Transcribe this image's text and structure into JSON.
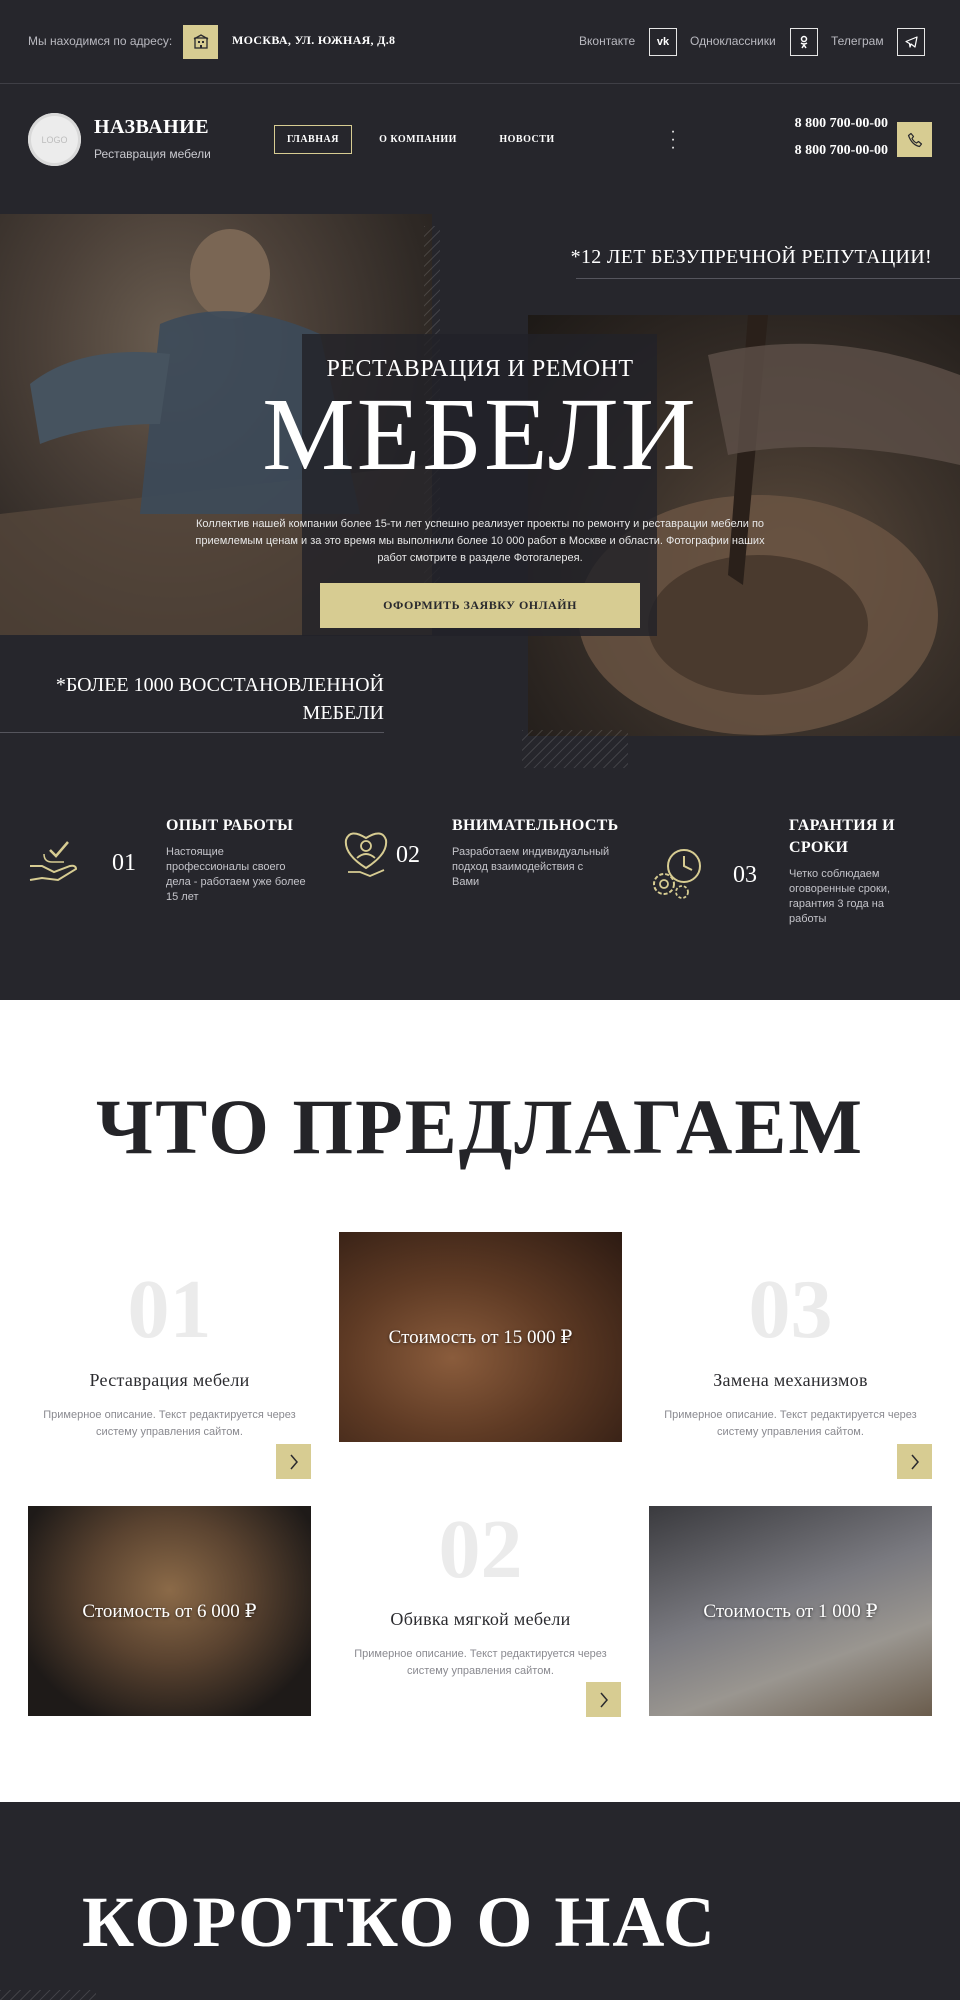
{
  "topbar": {
    "address_label": "Мы находимся по адресу:",
    "address_icon": "building-icon",
    "address": "МОСКВА, УЛ. ЮЖНАЯ, Д.8",
    "socials": [
      {
        "label": "Вконтакте",
        "glyph": "vk"
      },
      {
        "label": "Одноклассники",
        "glyph": "ok"
      },
      {
        "label": "Телеграм",
        "glyph": "telegram"
      }
    ]
  },
  "header": {
    "logo_text": "LOGO",
    "brand": "НАЗВАНИЕ",
    "brand_sub": "Реставрация мебели",
    "nav": [
      "ГЛАВНАЯ",
      "О КОМПАНИИ",
      "НОВОСТИ"
    ],
    "more_icon": "dots-vertical-icon",
    "phones": [
      "8 800 700-00-00",
      "8 800 700-00-00"
    ],
    "call_icon": "phone-icon"
  },
  "hero": {
    "subtitle": "РЕСТАВРАЦИЯ И РЕМОНТ",
    "title": "МЕБЕЛИ",
    "description": "Коллектив нашей компании более 15-ти лет успешно реализует проекты по ремонту и реставрации мебели по приемлемым ценам и за это время мы выполнили более 10 000 работ в Москве и области. Фотографии наших работ смотрите в разделе Фотогалерея.",
    "cta": "ОФОРМИТЬ ЗАЯВКУ ОНЛАЙН",
    "quote_right": "*12 ЛЕТ БЕЗУПРЕЧНОЙ РЕПУТАЦИИ!",
    "quote_left": "*БОЛЕЕ 1000 ВОССТАНОВЛЕННОЙ МЕБЕЛИ"
  },
  "features": [
    {
      "num": "01",
      "title": "ОПЫТ РАБОТЫ",
      "text": "Настоящие профессионалы своего дела - работаем уже более 15 лет",
      "icon": "hand-check-icon"
    },
    {
      "num": "02",
      "title": "ВНИМАТЕЛЬНОСТЬ",
      "text": "Разработаем индивидуальный подход взаимодействия с Вами",
      "icon": "heart-person-icon"
    },
    {
      "num": "03",
      "title": "ГАРАНТИЯ И СРОКИ",
      "text": "Четко соблюдаем оговоренные сроки, гарантия 3 года на работы",
      "icon": "gears-clock-icon"
    }
  ],
  "offers": {
    "title": "ЧТО ПРЕДЛАГАЕМ",
    "services": [
      {
        "num": "01",
        "title": "Реставрация мебели",
        "desc": "Примерное описание. Текст редактируется через систему управления сайтом."
      },
      {
        "num": "02",
        "title": "Обивка мягкой мебели",
        "desc": "Примерное описание. Текст редактируется через систему управления сайтом."
      },
      {
        "num": "03",
        "title": "Замена механизмов",
        "desc": "Примерное описание. Текст редактируется через систему управления сайтом."
      }
    ],
    "prices": [
      {
        "label": "Стоимость от 15 000 ₽"
      },
      {
        "label": "Стоимость от 6 000 ₽"
      },
      {
        "label": "Стоимость от 1 000 ₽"
      }
    ],
    "arrow_icon": "chevron-right-icon"
  },
  "about": {
    "title": "КОРОТКО О НАС"
  },
  "colors": {
    "accent": "#d7cc92",
    "dark_bg": "#26262c",
    "light_bg": "#ffffff"
  }
}
